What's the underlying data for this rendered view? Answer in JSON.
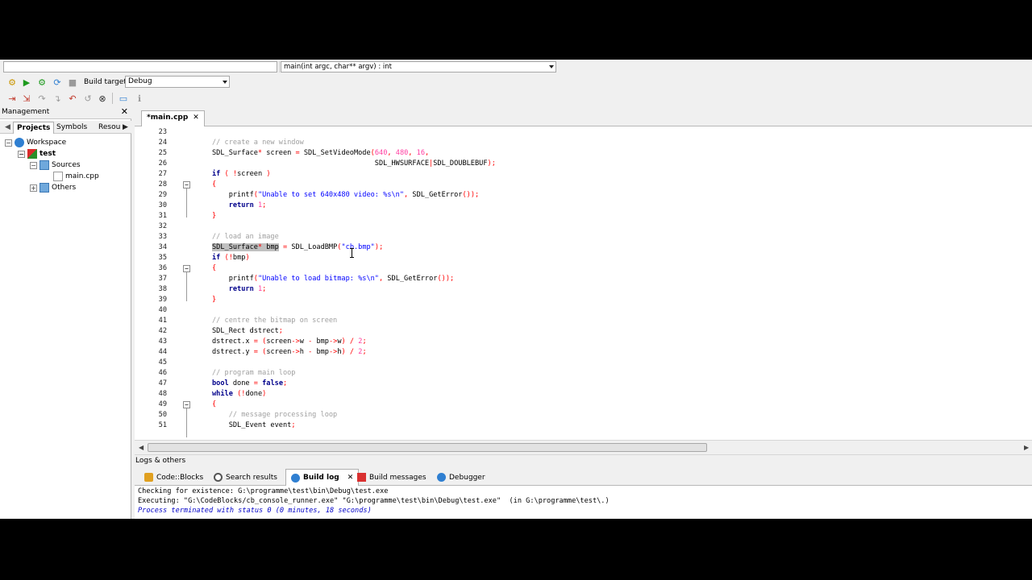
{
  "toolbar": {
    "function_scope": "main(int argc, char** argv) : int",
    "build_target_label": "Build target:",
    "build_target_value": "Debug"
  },
  "management": {
    "title": "Management",
    "tabs": [
      "Projects",
      "Symbols",
      "Resou"
    ],
    "tree": [
      {
        "label": "Workspace"
      },
      {
        "label": "test"
      },
      {
        "label": "Sources"
      },
      {
        "label": "main.cpp"
      },
      {
        "label": "Others"
      }
    ]
  },
  "editor": {
    "tab_label": "*main.cpp",
    "lines": [
      {
        "n": "23",
        "t": ""
      },
      {
        "n": "24",
        "t": "// create a new window"
      },
      {
        "n": "25",
        "t": "SDL_Surface* screen = SDL_SetVideoMode(640, 480, 16,"
      },
      {
        "n": "26",
        "t": "                                       SDL_HWSURFACE|SDL_DOUBLEBUF);"
      },
      {
        "n": "27",
        "t": "if ( !screen )"
      },
      {
        "n": "28",
        "t": "{"
      },
      {
        "n": "29",
        "t": "    printf(\"Unable to set 640x480 video: %s\\n\", SDL_GetError());"
      },
      {
        "n": "30",
        "t": "    return 1;"
      },
      {
        "n": "31",
        "t": "}"
      },
      {
        "n": "32",
        "t": ""
      },
      {
        "n": "33",
        "t": "// load an image"
      },
      {
        "n": "34",
        "t": "SDL_Surface* bmp = SDL_LoadBMP(\"cb.bmp\");"
      },
      {
        "n": "35",
        "t": "if (!bmp)"
      },
      {
        "n": "36",
        "t": "{"
      },
      {
        "n": "37",
        "t": "    printf(\"Unable to load bitmap: %s\\n\", SDL_GetError());"
      },
      {
        "n": "38",
        "t": "    return 1;"
      },
      {
        "n": "39",
        "t": "}"
      },
      {
        "n": "40",
        "t": ""
      },
      {
        "n": "41",
        "t": "// centre the bitmap on screen"
      },
      {
        "n": "42",
        "t": "SDL_Rect dstrect;"
      },
      {
        "n": "43",
        "t": "dstrect.x = (screen->w - bmp->w) / 2;"
      },
      {
        "n": "44",
        "t": "dstrect.y = (screen->h - bmp->h) / 2;"
      },
      {
        "n": "45",
        "t": ""
      },
      {
        "n": "46",
        "t": "// program main loop"
      },
      {
        "n": "47",
        "t": "bool done = false;"
      },
      {
        "n": "48",
        "t": "while (!done)"
      },
      {
        "n": "49",
        "t": "{"
      },
      {
        "n": "50",
        "t": "    // message processing loop"
      },
      {
        "n": "51",
        "t": "    SDL_Event event;"
      }
    ]
  },
  "logs": {
    "title": "Logs & others",
    "tabs": [
      "Code::Blocks",
      "Search results",
      "Build log",
      "Build messages",
      "Debugger"
    ],
    "lines": [
      "Checking for existence: G:\\programme\\test\\bin\\Debug\\test.exe",
      "Executing: \"G:\\CodeBlocks/cb_console_runner.exe\" \"G:\\programme\\test\\bin\\Debug\\test.exe\"  (in G:\\programme\\test\\.)",
      "Process terminated with status 0 (0 minutes, 18 seconds)"
    ]
  },
  "colors": {
    "keyword": "#00008b",
    "comment": "#a0a0a0",
    "number": "#ff3ca0",
    "string": "#0000ff",
    "operator": "#ff0000",
    "log_status": "#0000c8"
  }
}
